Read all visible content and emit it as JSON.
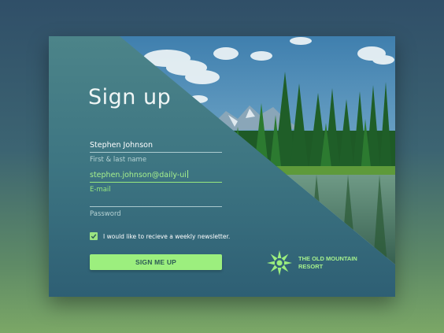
{
  "form": {
    "title": "Sign up",
    "name_value": "Stephen Johnson",
    "name_label": "First & last name",
    "email_value": "stephen.johnson@daily-ui",
    "email_label": "E-mail",
    "password_value": "",
    "password_label": "Password",
    "newsletter_label": "I would like to recieve a weekly newsletter.",
    "newsletter_checked": true,
    "submit_label": "SIGN ME UP"
  },
  "brand": {
    "line1": "THE OLD MOUNTAIN",
    "line2": "RESORT"
  },
  "colors": {
    "accent": "#9cef7e",
    "card": "#3d7582"
  },
  "icons": {
    "logo": "sun-star-icon",
    "check": "checkmark-icon"
  }
}
